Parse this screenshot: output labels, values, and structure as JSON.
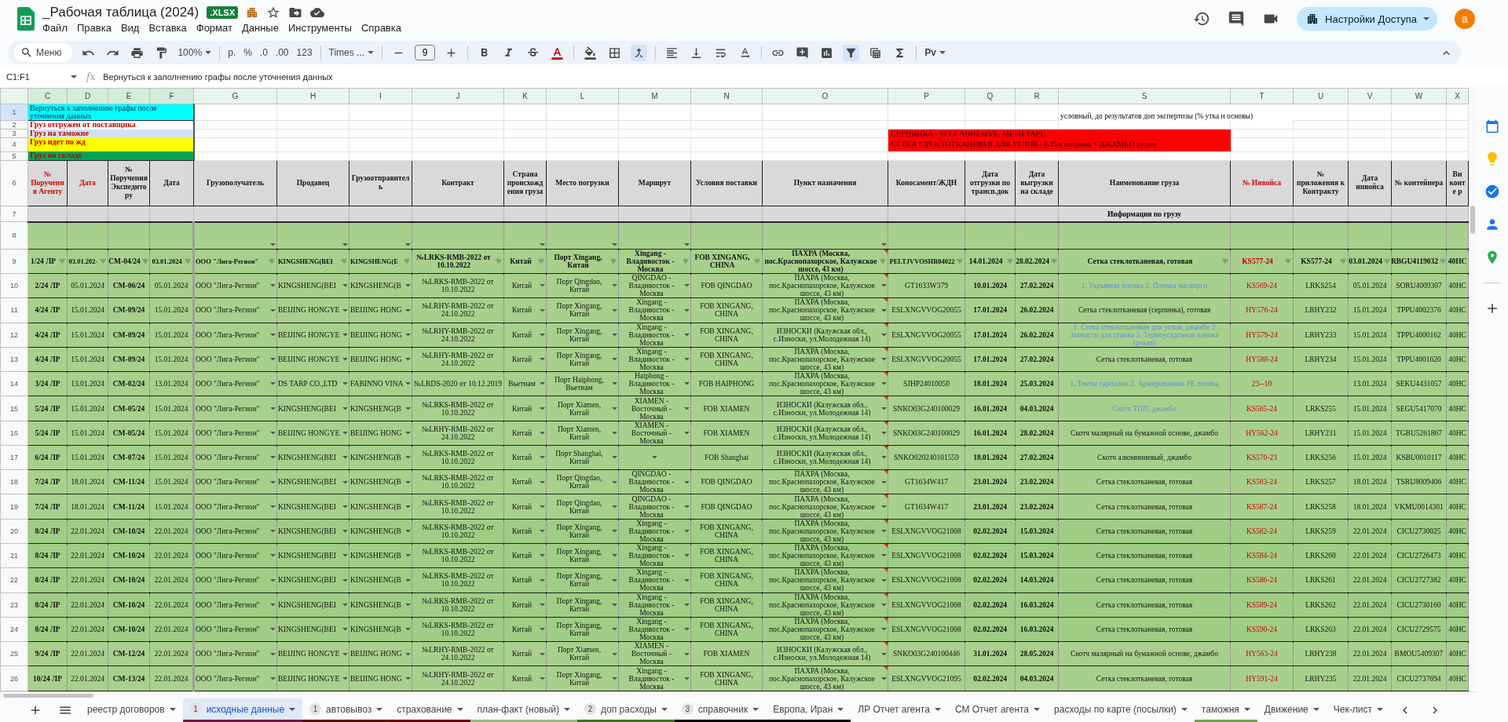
{
  "document": {
    "title": "_Рабочая таблица (2024)",
    "format_badge": ".XLSX",
    "menu": [
      "Файл",
      "Правка",
      "Вид",
      "Вставка",
      "Формат",
      "Данные",
      "Инструменты",
      "Справка"
    ],
    "share_button": "Настройки Доступа",
    "avatar": "a"
  },
  "toolbar": {
    "search_placeholder": "Меню",
    "zoom": "100%",
    "currency": "р.",
    "percent": "%",
    "decrease_decimals": ".0",
    "increase_decimals": ".00",
    "number_format": "123",
    "font": "Times ...",
    "font_size": "9",
    "input_tools": "Pv",
    "filter_on": true
  },
  "formula_bar": {
    "name_box": "C1:F1",
    "fx": "fx",
    "formula": "Вернуться к заполнению графы после уточнения данных"
  },
  "sheet": {
    "columns": [
      {
        "letter": "C",
        "header": "№ Поручения Агенту",
        "accent": true,
        "dropdown": false,
        "selected": true
      },
      {
        "letter": "D",
        "header": "Дата",
        "accent": true,
        "dropdown": false,
        "selected": true
      },
      {
        "letter": "E",
        "header": "№ Поручения Экспедитору",
        "accent": false,
        "dropdown": false,
        "selected": true
      },
      {
        "letter": "F",
        "header": "Дата",
        "accent": false,
        "dropdown": false,
        "selected": true
      },
      {
        "letter": "G",
        "header": "Грузополучатель",
        "accent": false,
        "dropdown": true,
        "selected": false
      },
      {
        "letter": "H",
        "header": "Продавец",
        "accent": false,
        "dropdown": true,
        "selected": false
      },
      {
        "letter": "I",
        "header": "Грузоотправитель",
        "accent": false,
        "dropdown": true,
        "selected": false
      },
      {
        "letter": "J",
        "header": "Контракт",
        "accent": false,
        "dropdown": false,
        "selected": false
      },
      {
        "letter": "K",
        "header": "Страна происхождения груза",
        "accent": false,
        "dropdown": true,
        "selected": false
      },
      {
        "letter": "L",
        "header": "Место погрузки",
        "accent": false,
        "dropdown": true,
        "selected": false
      },
      {
        "letter": "M",
        "header": "Маршрут",
        "accent": false,
        "dropdown": true,
        "selected": false
      },
      {
        "letter": "N",
        "header": "Условия поставки",
        "accent": false,
        "dropdown": false,
        "selected": false
      },
      {
        "letter": "O",
        "header": "Пункт назначения",
        "accent": false,
        "dropdown": true,
        "selected": false
      },
      {
        "letter": "P",
        "header": "Коносамент/ЖДН",
        "accent": false,
        "dropdown": false,
        "selected": false
      },
      {
        "letter": "Q",
        "header": "Дата отгрузки по трансп.док",
        "accent": false,
        "dropdown": false,
        "selected": false
      },
      {
        "letter": "R",
        "header": "Дата выгрузки на складе",
        "accent": false,
        "dropdown": false,
        "selected": false
      },
      {
        "letter": "S",
        "header": "Наименование груза",
        "accent": false,
        "dropdown": false,
        "selected": false
      },
      {
        "letter": "T",
        "header": "№ Инвойса",
        "accent": true,
        "dropdown": false,
        "selected": false
      },
      {
        "letter": "U",
        "header": "№ приложения к Контракту",
        "accent": false,
        "dropdown": false,
        "selected": false
      },
      {
        "letter": "V",
        "header": "Дата инвойса",
        "accent": false,
        "dropdown": false,
        "selected": false
      },
      {
        "letter": "W",
        "header": "№ контейнера",
        "accent": false,
        "dropdown": false,
        "selected": false
      },
      {
        "letter": "X",
        "header": "Ви конте р",
        "accent": false,
        "dropdown": false,
        "selected": false
      }
    ],
    "legend": [
      {
        "number": "1",
        "text": "Вернуться к заполнению графы после уточнения данных",
        "color": "#00ffff",
        "kind": "instruction",
        "selected": true
      },
      {
        "number": "2",
        "text": "Груз отгружен от поставщика",
        "color": "#ffffff",
        "kind": "status",
        "selected": false
      },
      {
        "number": "3",
        "text": "Груз на таможне",
        "color": "#cfe2f3",
        "kind": "status",
        "selected": false
      },
      {
        "number": "4",
        "text": "Груз идет по жд",
        "color": "#ffff00",
        "kind": "status",
        "selected": false
      },
      {
        "number": "5",
        "text": "Груз на складе",
        "color": "#00a651",
        "kind": "status",
        "selected": false
      }
    ],
    "note": "условный, до результатов доп экспертизы (% утка и основы)",
    "banner": {
      "color": "#ff0000",
      "lines": [
        "СЕРПЯНКА - SELF ADHESIVE, MESH TAPE",
        "СЕТКА СТЕКЛОТКАНЕВАЯ ДЛЯ УГЛОВ - 0,25м ширина + ДЖАМБО рулон"
      ]
    },
    "header_row": "6",
    "section_row": {
      "number": "7",
      "label": "Информация по грузу"
    },
    "dropdown_row": "8",
    "rows": [
      {
        "number": "9",
        "kind": "filter",
        "cargo_is_list": false,
        "note": true,
        "cells": [
          "1/24 ЛР",
          "03.01.202·",
          "СМ-04/24",
          "03.01.2024",
          "ООО \"Лига-Регион\"",
          "KINGSHENG(BEI",
          "KINGSHENG(E",
          "№LRKS-RMB-2022 от 10.10.2022",
          "Китай",
          "Порт Xingang, Китай",
          "Xingang - Владивосток - Москва",
          "FOB XINGANG, CHINA",
          "ПАХРА (Москва, пос.Краснопахорское, Калужское шоссе, 43 км)",
          "PELTJVVOSHR04022",
          "14.01.2024",
          "28.02.2024",
          "Сетка стеклотканевая, готовая",
          "KS577-24",
          "KS577-24",
          "03.01.2024",
          "RBGU4119032",
          "40HC"
        ]
      },
      {
        "number": "10",
        "kind": "data",
        "cargo_is_list": true,
        "note": true,
        "cells": [
          "2/24 ЛР",
          "05.01.2024",
          "СМ-06/24",
          "05.01.2024",
          "ООО \"Лига-Регион\"",
          "KINGSHENG(BEI",
          "KINGSHENG(B",
          "№LRKS-RMB-2022 от 10.10.2022",
          "Китай",
          "Порт Qingdao, Китай",
          "QINGDAO - Владивосток - Москва",
          "FOB QINGDAO",
          "ПАХРА (Москва, пос.Краснопахорское, Калужское шоссе, 43 км)",
          "GT1633W379",
          "10.01.2024",
          "27.02.2024",
          "1. Укрывная пленка 2. Пленка маскирги",
          "KS569-24",
          "LRKS254",
          "05.01.2024",
          "SORU4009307",
          "40HC"
        ]
      },
      {
        "number": "11",
        "kind": "data",
        "cargo_is_list": false,
        "note": true,
        "cells": [
          "4/24 ЛР",
          "15.01.2024",
          "СМ-09/24",
          "15.01.2024",
          "ООО \"Лига-Регион\"",
          "BEIJING HONGYE",
          "BEIJING HONG",
          "№LRHY-RMB-2022 от 24.10.2022",
          "Китай",
          "Порт Xingang, Китай",
          "Xingang - Владивосток - Москва",
          "FOB XINGANG, CHINA",
          "ПАХРА (Москва, пос.Краснопахорское, Калужское шоссе, 43 км)",
          "ESLXNGVVOG20055",
          "17.01.2024",
          "26.02.2024",
          "Сетка стеклотканевая (серпинка), готовая",
          "HY576-24",
          "LRHY232",
          "15.01.2024",
          "TPPU4002376",
          "40HC"
        ]
      },
      {
        "number": "12",
        "kind": "data",
        "cargo_is_list": true,
        "note": true,
        "cells": [
          "4/24 ЛР",
          "15.01.2024",
          "СМ-09/24",
          "15.01.2024",
          "ООО \"Лига-Регион\"",
          "BEIJING HONGYE",
          "BEIJING HONG",
          "№LRHY-RMB-2022 от 24.10.2022",
          "Китай",
          "Порт Xingang, Китай",
          "Xingang - Владивосток - Москва",
          "FOB XINGANG, CHINA",
          "ИЗНОСКИ (Калужская обл., с.Износки, ул.Молодежная 14)",
          "ESLXNGVVOG20055",
          "17.01.2024",
          "26.02.2024",
          "1. Сетка стеклотканевая для углов, джамбо 2 Запчасти для станка 3. Термоусадочная пленка (рукав)",
          "HY579-24",
          "LRHY233",
          "15.01.2024",
          "TPPU4000162",
          "40HC"
        ]
      },
      {
        "number": "13",
        "kind": "data",
        "cargo_is_list": false,
        "note": true,
        "cells": [
          "4/24 ЛР",
          "15.01.2024",
          "СМ-09/24",
          "15.01.2024",
          "ООО \"Лига-Регион\"",
          "BEIJING HONGYE",
          "BEIJING HONG",
          "№LRHY-RMB-2022 от 24.10.2022",
          "Китай",
          "Порт Xingang, Китай",
          "Xingang - Владивосток - Москва",
          "FOB XINGANG, CHINA",
          "ПАХРА (Москва, пос.Краснопахорское, Калужское шоссе, 43 км)",
          "ESLXNGVVOG20055",
          "17.01.2024",
          "27.02.2024",
          "Сетка стеклотканевая, готовая",
          "HY588-24",
          "LRHY234",
          "15.01.2024",
          "TPPU4001620",
          "40HC"
        ]
      },
      {
        "number": "14",
        "kind": "data",
        "cargo_is_list": true,
        "note": true,
        "cells": [
          "3/24 ЛР",
          "13.01.2024",
          "СМ-02/24",
          "13.01.2024",
          "ООО \"Лига-Регион\"",
          "DS TARP CO.,LTD",
          "FABINNO VINA",
          "№LRDS-2020 от 10.12.2019",
          "Вьетнам",
          "Порт Haiphong, Вьетнам",
          "Haiphong - Владивосток - Москва",
          "FOB HAIPHONG",
          "ПАХРА (Москва, пос.Краснопахорское, Калужское шоссе, 43 км)",
          "SJHP24010050",
          "18.01.2024",
          "25.03.2024",
          "1. Тенты тарпалин 2. Армированная PE пленка",
          "23--10",
          "",
          "13.01.2024",
          "SEKU4431057",
          "40HC"
        ]
      },
      {
        "number": "15",
        "kind": "data",
        "cargo_is_list": true,
        "note": true,
        "cells": [
          "5/24 ЛР",
          "15.01.2024",
          "СМ-05/24",
          "15.01.2024",
          "ООО \"Лига-Регион\"",
          "KINGSHENG(BEI",
          "KINGSHENG(B",
          "№LRKS-RMB-2022 от 10.10.2022",
          "Китай",
          "Порт Xiamen, Китай",
          "XIAMEN - Восточный - Москва",
          "FOB XIAMEN",
          "ИЗНОСКИ (Калужская обл., с.Износки, ул.Молодежная 14)",
          "SNKO03G240100029",
          "16.01.2024",
          "04.03.2024",
          "Скотч ТПП, джамбо",
          "KS565-24",
          "LRKS255",
          "15.01.2024",
          "SEGU5417070",
          "40HC"
        ]
      },
      {
        "number": "16",
        "kind": "data",
        "cargo_is_list": false,
        "note": true,
        "cells": [
          "5/24 ЛР",
          "15.01.2024",
          "СМ-05/24",
          "15.01.2024",
          "ООО \"Лига-Регион\"",
          "BEIJING HONGYE",
          "BEIJING HONG",
          "№LRHY-RMB-2022 от 24.10.2022",
          "Китай",
          "Порт Xiamen, Китай",
          "XIAMEN - Восточный - Москва",
          "FOB XIAMEN",
          "ИЗНОСКИ (Калужская обл., с.Износки, ул.Молодежная 14)",
          "SNKO03G240100029",
          "16.01.2024",
          "28.02.2024",
          "Скотч малярный на бумажной основе, джамбо",
          "HY562-24",
          "LRHY231",
          "15.01.2024",
          "TGBU5261867",
          "40HC"
        ]
      },
      {
        "number": "17",
        "kind": "data",
        "cargo_is_list": false,
        "note": true,
        "cells": [
          "6/24 ЛР",
          "15.01.2024",
          "СМ-07/24",
          "15.01.2024",
          "ООО \"Лига-Регион\"",
          "KINGSHENG(BEI",
          "KINGSHENG(B",
          "№LRKS-RMB-2022 от 10.10.2022",
          "Китай",
          "Порт Shanghai, Китай",
          "",
          "FOB Shanghai",
          "ИЗНОСКИ (Калужская обл., с.Износки, ул.Молодежная 14)",
          "SNKO020240101559",
          "18.01.2024",
          "27.02.2024",
          "Скотч алюминиевый, джамбо",
          "KS570-23",
          "LRKS256",
          "15.01.2024",
          "KSBU0010117",
          "40HC"
        ]
      },
      {
        "number": "18",
        "kind": "data",
        "cargo_is_list": false,
        "note": true,
        "cells": [
          "7/24 ЛР",
          "18.01.2024",
          "СМ-11/24",
          "15.01.2024",
          "ООО \"Лига-Регион\"",
          "KINGSHENG(BEI",
          "KINGSHENG(B",
          "№LRKS-RMB-2022 от 10.10.2022",
          "Китай",
          "Порт Qingdao, Китай",
          "QINGDAO - Владивосток - Москва",
          "FOB QINGDAO",
          "ПАХРА (Москва, пос.Краснопахорское, Калужское шоссе, 43 км)",
          "GT1634W417",
          "23.01.2024",
          "23.02.2024",
          "Сетка стеклотканевая, готовая",
          "KS583-24",
          "LRKS257",
          "18.01.2024",
          "TSRU8009406",
          "40HC"
        ]
      },
      {
        "number": "19",
        "kind": "data",
        "cargo_is_list": false,
        "note": true,
        "cells": [
          "7/24 ЛР",
          "18.01.2024",
          "СМ-11/24",
          "15.01.2024",
          "ООО \"Лига-Регион\"",
          "KINGSHENG(BEI",
          "KINGSHENG(B",
          "№LRKS-RMB-2022 от 10.10.2022",
          "Китай",
          "Порт Qingdao, Китай",
          "QINGDAO - Владивосток - Москва",
          "FOB QINGDAO",
          "ПАХРА (Москва, пос.Краснопахорское, Калужское шоссе, 43 км)",
          "GT1634W417",
          "23.01.2024",
          "23.02.2024",
          "Сетка стеклотканевая, готовая",
          "KS587-24",
          "LRKS258",
          "18.01.2024",
          "VKMU0014301",
          "40HC"
        ]
      },
      {
        "number": "20",
        "kind": "data",
        "cargo_is_list": false,
        "note": true,
        "cells": [
          "8/24 ЛР",
          "22.01.2024",
          "СМ-10/24",
          "22.01.2024",
          "ООО \"Лига-Регион\"",
          "KINGSHENG(BEI",
          "KINGSHENG(B",
          "№LRKS-RMB-2022 от 10.10.2022",
          "Китай",
          "Порт Xingang, Китай",
          "Xingang - Владивосток - Москва",
          "FOB XINGANG, CHINA",
          "ПАХРА (Москва, пос.Краснопахорское, Калужское шоссе, 43 км)",
          "ESLXNGVVOG21008",
          "02.02.2024",
          "15.03.2024",
          "Сетка стеклотканевая, готовая",
          "KS582-24",
          "LRKS259",
          "22.01.2024",
          "CICU2730025",
          "40HC"
        ]
      },
      {
        "number": "21",
        "kind": "data",
        "cargo_is_list": false,
        "note": true,
        "cells": [
          "8/24 ЛР",
          "22.01.2024",
          "СМ-10/24",
          "22.01.2024",
          "ООО \"Лига-Регион\"",
          "KINGSHENG(BEI",
          "KINGSHENG(B",
          "№LRKS-RMB-2022 от 10.10.2022",
          "Китай",
          "Порт Xingang, Китай",
          "Xingang - Владивосток - Москва",
          "FOB XINGANG, CHINA",
          "ПАХРА (Москва, пос.Краснопахорское, Калужское шоссе, 43 км)",
          "ESLXNGVVOG21008",
          "02.02.2024",
          "15.03.2024",
          "Сетка стеклотканевая, готовая",
          "KS584-24",
          "LRKS260",
          "22.01.2024",
          "CICU2726473",
          "40HC"
        ]
      },
      {
        "number": "22",
        "kind": "data",
        "cargo_is_list": false,
        "note": true,
        "cells": [
          "8/24 ЛР",
          "22.01.2024",
          "СМ-10/24",
          "22.01.2024",
          "ООО \"Лига-Регион\"",
          "KINGSHENG(BEI",
          "KINGSHENG(B",
          "№LRKS-RMB-2022 от 10.10.2022",
          "Китай",
          "Порт Xingang, Китай",
          "Xingang - Владивосток - Москва",
          "FOB XINGANG, CHINA",
          "ПАХРА (Москва, пос.Краснопахорское, Калужское шоссе, 43 км)",
          "ESLXNGVVOG21008",
          "02.02.2024",
          "14.03.2024",
          "Сетка стеклотканевая, готовая",
          "KS586-24",
          "LRKS261",
          "22.01.2024",
          "CICU2727382",
          "40HC"
        ]
      },
      {
        "number": "23",
        "kind": "data",
        "cargo_is_list": false,
        "note": true,
        "cells": [
          "8/24 ЛР",
          "22.01.2024",
          "СМ-10/24",
          "22.01.2024",
          "ООО \"Лига-Регион\"",
          "KINGSHENG(BEI",
          "KINGSHENG(B",
          "№LRKS-RMB-2022 от 10.10.2022",
          "Китай",
          "Порт Xingang, Китай",
          "Xingang - Владивосток - Москва",
          "FOB XINGANG, CHINA",
          "ПАХРА (Москва, пос.Краснопахорское, Калужское шоссе, 43 км)",
          "ESLXNGVVOG21008",
          "02.02.2024",
          "16.03.2024",
          "Сетка стеклотканевая, готовая",
          "KS589-24",
          "LRKS262",
          "22.01.2024",
          "CICU2730160",
          "40HC"
        ]
      },
      {
        "number": "24",
        "kind": "data",
        "cargo_is_list": false,
        "note": true,
        "cells": [
          "8/24 ЛР",
          "22.01.2024",
          "СМ-10/24",
          "22.01.2024",
          "ООО \"Лига-Регион\"",
          "KINGSHENG(BEI",
          "KINGSHENG(B",
          "№LRKS-RMB-2022 от 10.10.2022",
          "Китай",
          "Порт Xingang, Китай",
          "Xingang - Владивосток - Москва",
          "FOB XINGANG, CHINA",
          "ПАХРА (Москва, пос.Краснопахорское, Калужское шоссе, 43 км)",
          "ESLXNGVVOG21008",
          "02.02.2024",
          "16.03.2024",
          "Сетка стеклотканевая, готовая",
          "KS590-24",
          "LRKS263",
          "22.01.2024",
          "CICU2729575",
          "40HC"
        ]
      },
      {
        "number": "25",
        "kind": "data",
        "cargo_is_list": false,
        "note": true,
        "cells": [
          "9/24 ЛР",
          "22.01.2024",
          "СМ-12/24",
          "22.01.2024",
          "ООО \"Лига-Регион\"",
          "BEIJING HONGYE",
          "BEIJING HONG",
          "№LRHY-RMB-2022 от 24.10.2022",
          "Китай",
          "Порт Xiamen, Китай",
          "XIAMEN - Восточный - Москва",
          "FOB XIAMEN",
          "ИЗНОСКИ (Калужская обл., с.Износки, ул.Молодежная 14)",
          "SNKO03G240100446",
          "31.01.2024",
          "28.05.2024",
          "Скотч малярный на бумажной основе, джамбо",
          "HY563-24",
          "LRHY238",
          "22.01.2024",
          "BMOU5409307",
          "40HC"
        ]
      },
      {
        "number": "26",
        "kind": "data",
        "cargo_is_list": false,
        "note": true,
        "cells": [
          "10/24 ЛР",
          "22.01.2024",
          "СМ-13/24",
          "22.01.2024",
          "ООО \"Лига-Регион\"",
          "BEIJING HONGYE",
          "BEIJING HONG",
          "№LRHY-RMB-2022 от 24.10.2022",
          "Китай",
          "Порт Xingang, Китай",
          "Xingang - Владивосток - Москва",
          "FOB XINGANG, CHINA",
          "ПАХРА (Москва, пос.Краснопахорское, Калужское шоссе, 43 км)",
          "ESLXNGVVOG21095",
          "02.02.2024",
          "04.03.2024",
          "Сетка стеклотканевая, готовая",
          "HY591-24",
          "LRHY235",
          "22.01.2024",
          "CICU2737694",
          "40HC"
        ]
      }
    ]
  },
  "sheet_tabs": [
    {
      "label": "реестр договоров",
      "selected": false
    },
    {
      "label": "исходные данные",
      "badge": "1",
      "selected": true,
      "color": "#741b47"
    },
    {
      "label": "автовывоз",
      "badge": "1",
      "selected": false,
      "color": "#5b0f00"
    },
    {
      "label": "страхование",
      "selected": false,
      "color": "#660000"
    },
    {
      "label": "план-факт (новый)",
      "selected": false,
      "color": "#93c47d"
    },
    {
      "label": "доп расходы",
      "badge": "2",
      "selected": false,
      "color": "#38761d"
    },
    {
      "label": "справочник",
      "badge": "3",
      "selected": false,
      "color": "#000000"
    },
    {
      "label": "Европа, Иран",
      "selected": false,
      "color": "#000000"
    },
    {
      "label": "ЛР Отчет агента",
      "selected": false
    },
    {
      "label": "СМ Отчет агента",
      "selected": false
    },
    {
      "label": "расходы по карте (посылки)",
      "selected": false
    },
    {
      "label": "таможня",
      "selected": false,
      "color": "#6aa84f"
    },
    {
      "label": "Движение",
      "selected": false
    },
    {
      "label": "Чек-лист",
      "selected": false
    }
  ]
}
